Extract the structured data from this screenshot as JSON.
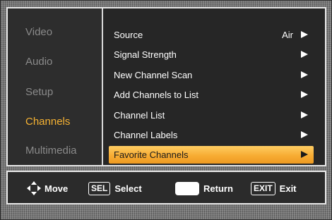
{
  "categories": [
    {
      "label": "Video",
      "active": false
    },
    {
      "label": "Audio",
      "active": false
    },
    {
      "label": "Setup",
      "active": false
    },
    {
      "label": "Channels",
      "active": true
    },
    {
      "label": "Multimedia",
      "active": false
    }
  ],
  "options": [
    {
      "label": "Source",
      "value": "Air",
      "highlighted": false
    },
    {
      "label": "Signal Strength",
      "value": "",
      "highlighted": false
    },
    {
      "label": "New Channel Scan",
      "value": "",
      "highlighted": false
    },
    {
      "label": "Add Channels to List",
      "value": "",
      "highlighted": false
    },
    {
      "label": "Channel List",
      "value": "",
      "highlighted": false
    },
    {
      "label": "Channel Labels",
      "value": "",
      "highlighted": false
    },
    {
      "label": "Favorite Channels",
      "value": "",
      "highlighted": true
    }
  ],
  "footer": {
    "move_label": "Move",
    "sel_key": "SEL",
    "select_label": "Select",
    "return_label": "Return",
    "exit_key": "EXIT",
    "exit_label": "Exit"
  },
  "colors": {
    "accent": "#f5b233",
    "highlight_bar": "#f7ac33",
    "panel_bg": "#2b2b2b",
    "inactive_text": "#8a8a8a"
  },
  "icons": {
    "move": "four-way-arrow-icon",
    "submenu": "right-triangle-arrow-icon",
    "return": "return-key-icon"
  }
}
